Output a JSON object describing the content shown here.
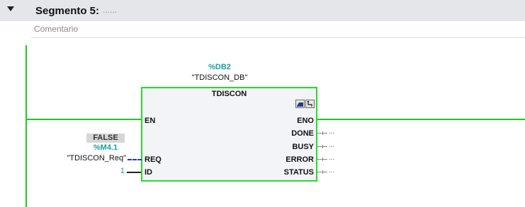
{
  "segment": {
    "title": "Segmento 5:",
    "description": "......",
    "comment_placeholder": "Comentario"
  },
  "instance": {
    "db_address": "%DB2",
    "db_name": "\"TDISCON_DB\""
  },
  "block": {
    "name": "TDISCON",
    "icons": [
      "instance-db-icon",
      "network-diagnostic-icon"
    ],
    "inputs": [
      "EN",
      "REQ",
      "ID"
    ],
    "outputs": [
      "ENO",
      "DONE",
      "BUSY",
      "ERROR",
      "STATUS"
    ]
  },
  "req_param": {
    "monitor_value": "FALSE",
    "address": "%M4.1",
    "tag": "\"TDISCON_Req\""
  },
  "id_param": {
    "value": "1"
  },
  "output_placeholder": "...",
  "colors": {
    "rail": "#21c821",
    "block_border": "#22dd22",
    "address": "#1aa0a0",
    "false_wire": "#2233cc",
    "header_bg": "#e4e6ea"
  }
}
